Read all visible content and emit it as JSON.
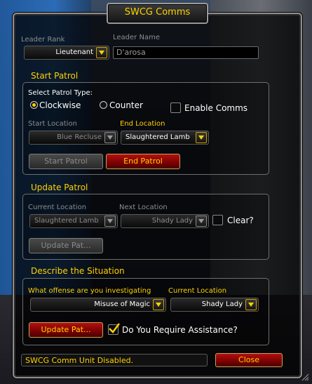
{
  "window": {
    "title": "SWCG Comms"
  },
  "leader": {
    "rank_label": "Leader Rank",
    "rank_value": "Lieutenant",
    "name_label": "Leader Name",
    "name_value": "D'arosa"
  },
  "start_patrol": {
    "header": "Start Patrol",
    "type_label": "Select Patrol Type:",
    "clockwise_label": "Clockwise",
    "counter_label": "Counter",
    "selected_type": "Clockwise",
    "enable_comms_label": "Enable Comms",
    "enable_comms_checked": false,
    "start_location_label": "Start Location",
    "start_location_value": "Blue Recluse",
    "end_location_label": "End Location",
    "end_location_value": "Slaughtered Lamb",
    "start_button": "Start Patrol",
    "end_button": "End Patrol"
  },
  "update_patrol": {
    "header": "Update Patrol",
    "current_location_label": "Current Location",
    "current_location_value": "Slaughtered Lamb",
    "next_location_label": "Next Location",
    "next_location_value": "Shady Lady",
    "clear_label": "Clear?",
    "clear_checked": false,
    "update_button": "Update Pat..."
  },
  "situation": {
    "header": "Describe the Situation",
    "offense_label": "What offense are you investigating",
    "offense_value": "Misuse of Magic",
    "current_location_label": "Current Location",
    "current_location_value": "Shady Lady",
    "update_button": "Update Pat...",
    "assistance_label": "Do You Require Assistance?",
    "assistance_checked": true
  },
  "footer": {
    "status_text": "SWCG Comm Unit Disabled.",
    "close_button": "Close"
  },
  "colors": {
    "gold": "#ffd100",
    "grey_label": "#8d8d8d",
    "red_button": "#9a0000"
  },
  "icons": [
    "dropdown-arrow-icon",
    "checkmark-icon",
    "resize-grip-icon"
  ]
}
